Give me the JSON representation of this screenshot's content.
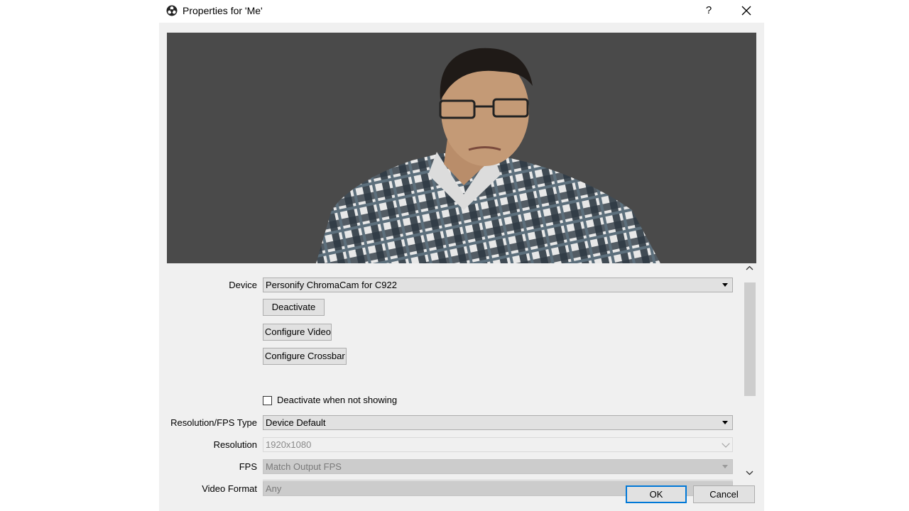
{
  "window": {
    "title": "Properties for 'Me'",
    "help_label": "?",
    "close_icon": "close-icon",
    "app_icon": "obs-logo-icon"
  },
  "preview": {
    "background_color": "#4a4a4a",
    "content": "webcam-person-image"
  },
  "form": {
    "device": {
      "label": "Device",
      "value": "Personify ChromaCam for C922"
    },
    "buttons": {
      "deactivate": "Deactivate",
      "configure_video": "Configure Video",
      "configure_crossbar": "Configure Crossbar"
    },
    "deactivate_when_not_showing": {
      "label": "Deactivate when not showing",
      "checked": false
    },
    "resolution_fps_type": {
      "label": "Resolution/FPS Type",
      "value": "Device Default"
    },
    "resolution": {
      "label": "Resolution",
      "value": "1920x1080"
    },
    "fps": {
      "label": "FPS",
      "value": "Match Output FPS"
    },
    "video_format": {
      "label": "Video Format",
      "value": "Any"
    }
  },
  "footer": {
    "ok_label": "OK",
    "cancel_label": "Cancel"
  },
  "colors": {
    "dialog_bg": "#f0f0f0",
    "accent": "#0078d7"
  }
}
